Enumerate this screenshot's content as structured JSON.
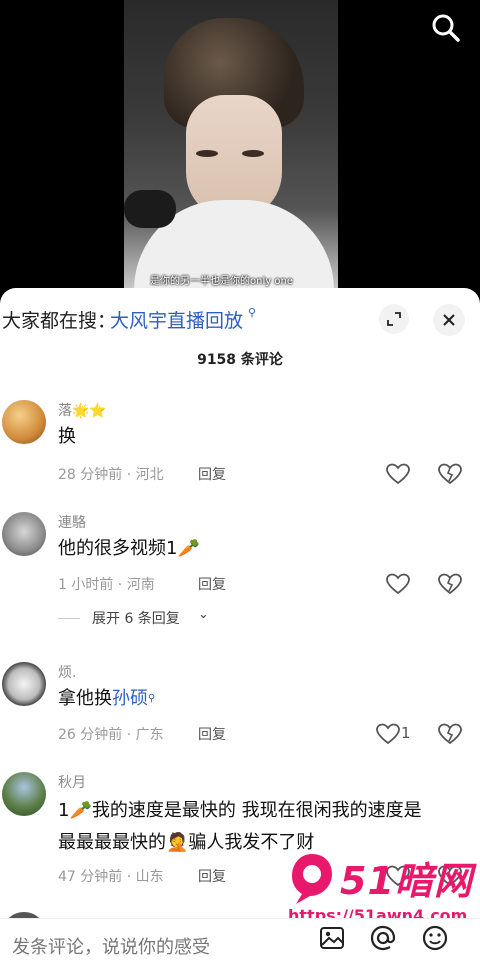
{
  "video": {
    "subtitle": "是你的另一半也是你的only one"
  },
  "hot_search": {
    "prefix": "大家都在搜：",
    "term": "大风宇直播回放"
  },
  "comment_count": "9158 条评论",
  "comments": [
    {
      "name": "落🌟⭐",
      "text": "换",
      "meta": "28 分钟前 · 河北",
      "reply": "回复",
      "likes": ""
    },
    {
      "name": "連駱",
      "text": "他的很多视频1🥕",
      "meta": "1 小时前 · 河南",
      "reply": "回复",
      "likes": "",
      "expand": "展开 6 条回复"
    },
    {
      "name": "烦.",
      "text_prefix": "拿他换",
      "text_link": "孙硕",
      "meta": "26 分钟前 · 广东",
      "reply": "回复",
      "likes": "1"
    },
    {
      "name": "秋月",
      "text_line1": "1🥕我的速度是最快的 我现在很闲我的速度是",
      "text_line2": "最最最最快的🤦骗人我发不了财",
      "meta": "47 分钟前 · 山东",
      "reply": "回复",
      "likes": ""
    }
  ],
  "input": {
    "placeholder": "发条评论，说说你的感受"
  },
  "watermark": {
    "title": "51暗网",
    "url": "https://51awn4.com"
  },
  "icons": {
    "search": "search-icon",
    "expand": "expand-icon",
    "close": "close-icon",
    "like": "heart-icon",
    "dislike": "broken-heart-icon",
    "image": "image-icon",
    "mention": "at-icon",
    "emoji": "emoji-icon"
  },
  "colors": {
    "link": "#2f5fbf",
    "watermark": "#e8186c"
  }
}
